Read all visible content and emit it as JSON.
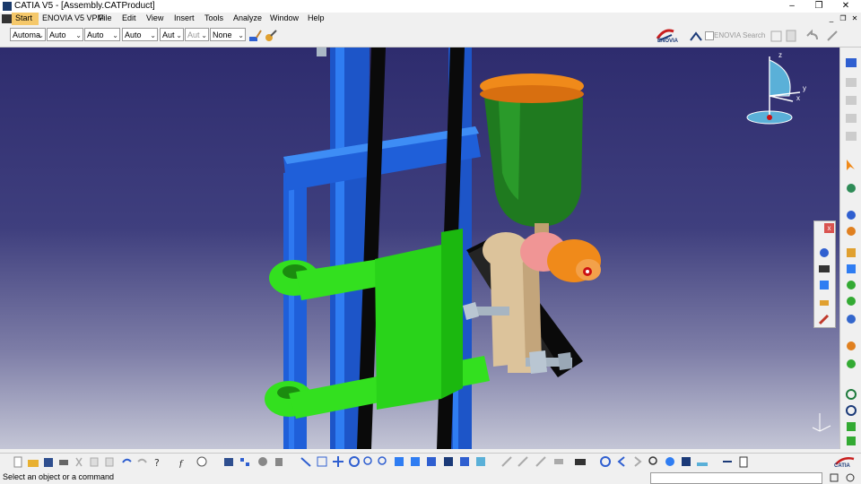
{
  "window": {
    "title": "CATIA V5 - [Assembly.CATProduct]",
    "minimize": "–",
    "restore": "❐",
    "close": "✕"
  },
  "menu": {
    "items": [
      "Start",
      "ENOVIA V5 VPM",
      "File",
      "Edit",
      "View",
      "Insert",
      "Tools",
      "Analyze",
      "Window",
      "Help"
    ],
    "mdi_minimize": "_",
    "mdi_restore": "❐",
    "mdi_close": "✕"
  },
  "style_toolbar": {
    "combos": [
      "Automa",
      "Auto",
      "Auto",
      "Auto",
      "Aut",
      "Aut",
      "None"
    ],
    "enovia_logo": "ENOVIA",
    "enovia_search": "ENOVIA Search"
  },
  "viewport": {
    "compass": {
      "x_label": "x",
      "y_label": "y",
      "z_label": "z"
    },
    "colors": {
      "rail_blue": "#1f5fd9",
      "belt": "#0a0a0a",
      "bracket_green": "#33e01f",
      "cup_green": "#1f7a1f",
      "lid_orange": "#f08a1a",
      "tan": "#dcc39b",
      "pink": "#f09595",
      "bolt": "#a7b5c2"
    }
  },
  "floating_toolbar": {
    "close": "x"
  },
  "bottom_toolbar": {
    "brand": "CATIA"
  },
  "status": {
    "text": "Select an object or a command"
  }
}
